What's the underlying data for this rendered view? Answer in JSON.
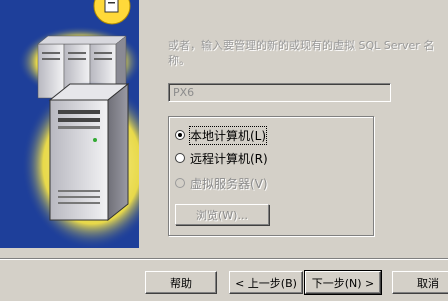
{
  "instruction": "或者，输入要管理的新的或现有的虚拟 SQL Server 名称。",
  "server_name_field": {
    "value": "PX6"
  },
  "options": [
    {
      "label": "本地计算机(L)",
      "checked": true,
      "enabled": true
    },
    {
      "label": "远程计算机(R)",
      "checked": false,
      "enabled": true
    },
    {
      "label": "虚拟服务器(V)",
      "checked": false,
      "enabled": false
    }
  ],
  "browse_label": "浏览(W)...",
  "buttons": {
    "help": "帮助",
    "back": "< 上一步(B)",
    "next": "下一步(N) >",
    "cancel": "取消"
  },
  "colors": {
    "art_background": "#1e3f9a",
    "dialog_face": "#d4d0c8",
    "disabled_text": "#8c8c8c"
  },
  "icons": [
    "server-tower-icon",
    "server-rack-icon",
    "document-badge-icon"
  ]
}
